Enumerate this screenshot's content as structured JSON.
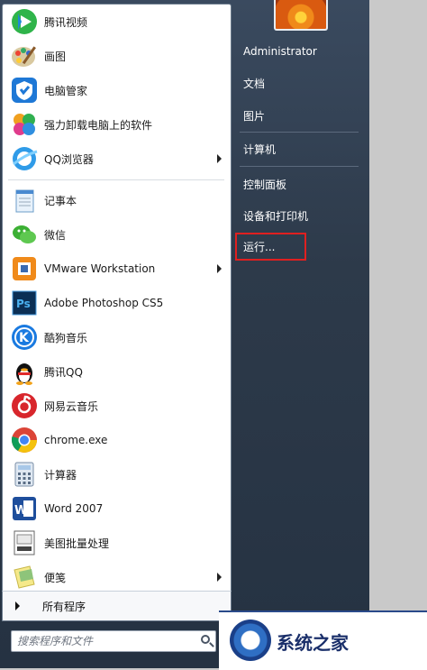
{
  "programs": [
    {
      "label": "腾讯视频",
      "icon": "tencent-video-icon",
      "arrow": false
    },
    {
      "label": "画图",
      "icon": "paint-icon",
      "arrow": false
    },
    {
      "label": "电脑管家",
      "icon": "pc-manager-icon",
      "arrow": false
    },
    {
      "label": "强力卸载电脑上的软件",
      "icon": "uninstall-icon",
      "arrow": false
    },
    {
      "label": "QQ浏览器",
      "icon": "qq-browser-icon",
      "arrow": true
    },
    {
      "label": "记事本",
      "icon": "notepad-icon",
      "arrow": false
    },
    {
      "label": "微信",
      "icon": "wechat-icon",
      "arrow": false
    },
    {
      "label": "VMware Workstation",
      "icon": "vmware-icon",
      "arrow": true
    },
    {
      "label": "Adobe Photoshop CS5",
      "icon": "photoshop-icon",
      "arrow": false
    },
    {
      "label": "酷狗音乐",
      "icon": "kugou-icon",
      "arrow": false
    },
    {
      "label": "腾讯QQ",
      "icon": "qq-penguin-icon",
      "arrow": false
    },
    {
      "label": "网易云音乐",
      "icon": "netease-music-icon",
      "arrow": false
    },
    {
      "label": "chrome.exe",
      "icon": "chrome-icon",
      "arrow": false
    },
    {
      "label": "计算器",
      "icon": "calculator-icon",
      "arrow": false
    },
    {
      "label": "Word 2007",
      "icon": "word-icon",
      "arrow": false
    },
    {
      "label": "美图批量处理",
      "icon": "meitu-batch-icon",
      "arrow": false
    },
    {
      "label": "便笺",
      "icon": "sticky-notes-icon",
      "arrow": true
    }
  ],
  "all_programs": "所有程序",
  "search": {
    "placeholder": "搜索程序和文件"
  },
  "right_items": {
    "user": "Administrator",
    "documents": "文档",
    "pictures": "图片",
    "computer": "计算机",
    "control_panel": "控制面板",
    "devices": "设备和打印机",
    "run": "运行..."
  },
  "watermark": {
    "text": "系统之家"
  },
  "colors": {
    "highlight": "#e02020",
    "menu_bg": "#2d3a4a"
  }
}
